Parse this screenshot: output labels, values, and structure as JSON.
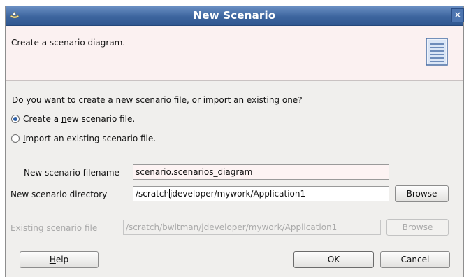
{
  "window": {
    "title": "New Scenario"
  },
  "header": {
    "description": "Create a scenario diagram."
  },
  "question": "Do you want to create a new scenario file, or import an existing one?",
  "options": [
    {
      "pre": "Create a ",
      "mnemonic": "n",
      "post": "ew scenario file.",
      "selected": true
    },
    {
      "pre": "",
      "mnemonic": "I",
      "post": "mport an existing scenario file.",
      "selected": false
    }
  ],
  "fields": {
    "filename": {
      "label": "New scenario filename",
      "value": "scenario.scenarios_diagram"
    },
    "directory": {
      "label": "New scenario directory",
      "value_before_caret": "/scratch",
      "value_after_caret": "jdeveloper/mywork/Application1",
      "browse": "Browse"
    },
    "existing": {
      "label": "Existing scenario file",
      "value": "/scratch/bwitman/jdeveloper/mywork/Application1",
      "browse": "Browse"
    }
  },
  "buttons": {
    "help_mnemonic": "H",
    "help_rest": "elp",
    "ok": "OK",
    "cancel": "Cancel"
  },
  "colors": {
    "title_bar": "#3d659e",
    "header_bg": "#fbf1f1",
    "dialog_bg": "#f0efed",
    "selected_radio": "#2c5fa6"
  },
  "icons": {
    "app": "jdeveloper-app-icon",
    "close": "close-icon",
    "header": "document-icon"
  }
}
